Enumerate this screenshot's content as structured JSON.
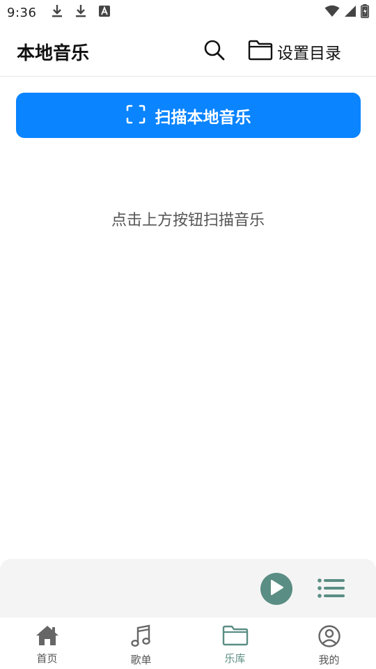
{
  "status_bar": {
    "time": "9:36",
    "icons": [
      "download-icon",
      "download-icon",
      "font-a-icon",
      "wifi-icon",
      "signal-icon",
      "battery-charging-icon"
    ]
  },
  "header": {
    "title": "本地音乐",
    "search_icon": "search-icon",
    "set_dir_label": "设置目录",
    "set_dir_icon": "folder-icon"
  },
  "scan": {
    "label": "扫描本地音乐",
    "icon": "scan-frame-icon",
    "color": "#0a84ff"
  },
  "empty_state": {
    "hint": "点击上方按钮扫描音乐"
  },
  "player": {
    "play_icon": "play-icon",
    "playlist_icon": "playlist-icon",
    "accent": "#5a8d83"
  },
  "bottom_nav": {
    "items": [
      {
        "label": "首页",
        "icon": "home-icon",
        "active": false
      },
      {
        "label": "歌单",
        "icon": "music-note-icon",
        "active": false
      },
      {
        "label": "乐库",
        "icon": "folder-icon",
        "active": true
      },
      {
        "label": "我的",
        "icon": "user-circle-icon",
        "active": false
      }
    ]
  }
}
